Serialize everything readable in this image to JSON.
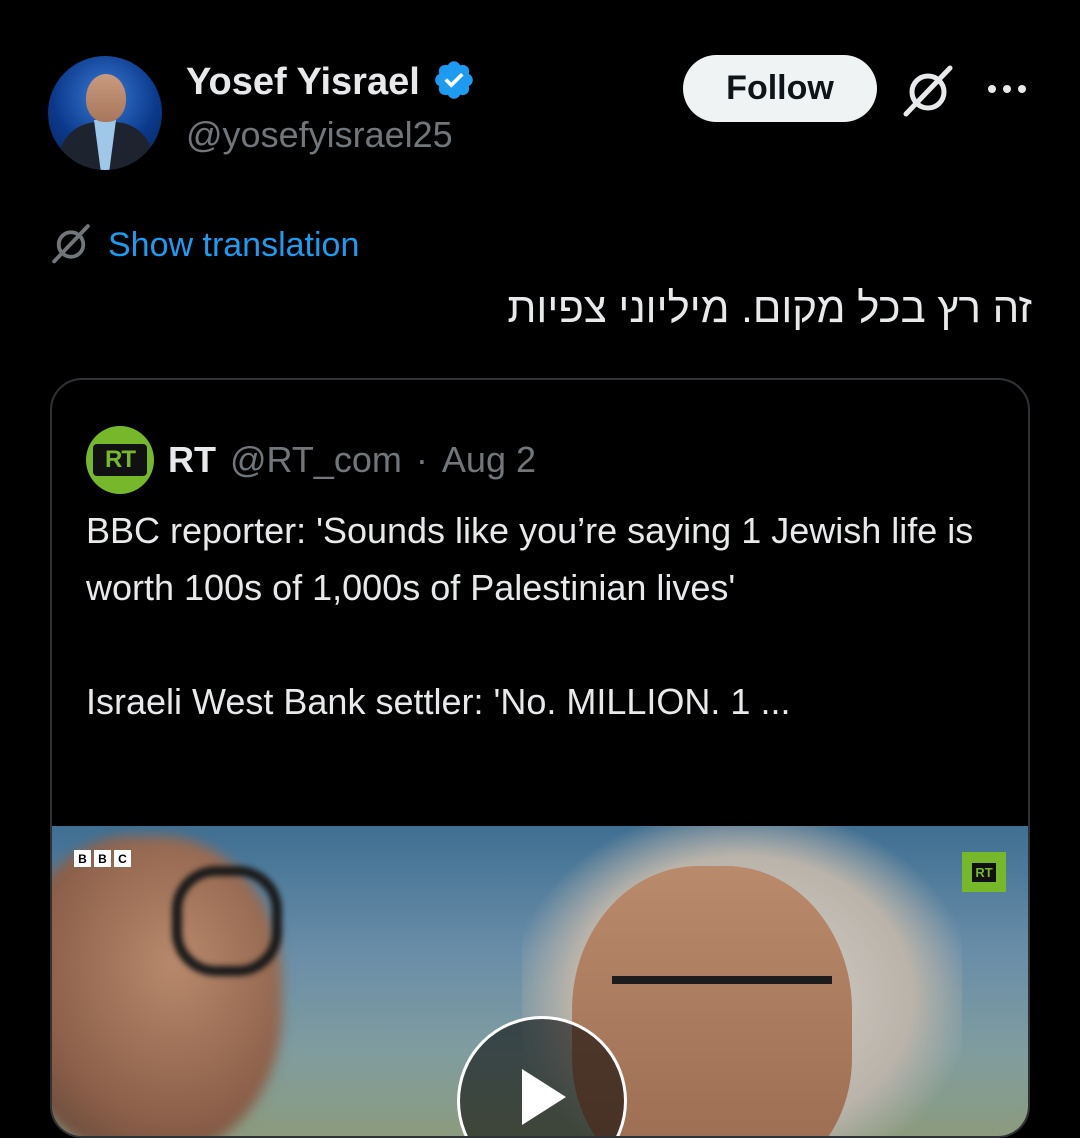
{
  "author": {
    "name": "Yosef Yisrael",
    "handle": "@yosefyisrael25",
    "verified_color": "#1d9bf0"
  },
  "actions": {
    "follow_label": "Follow",
    "grok_icon": "grok-icon",
    "more_icon": "more-icon"
  },
  "translation": {
    "label": "Show translation"
  },
  "post": {
    "text": "זה רץ בכל מקום. מיליוני צפיות"
  },
  "quote": {
    "avatar_label": "RT",
    "name": "RT",
    "handle": "@RT_com",
    "separator": "·",
    "date": "Aug 2",
    "text": "BBC reporter: 'Sounds like you’re saying 1 Jewish life is worth 100s of 1,000s of Palestinian lives'\n\nIsraeli West Bank settler: 'No. MILLION. 1 ...",
    "media": {
      "bbc_letters": [
        "B",
        "B",
        "C"
      ],
      "rt_watermark": "RT",
      "play_icon": "play-icon"
    }
  },
  "colors": {
    "background": "#000000",
    "text": "#e7e9ea",
    "muted": "#71767b",
    "link": "#1d9bf0",
    "rt_green": "#76b82a"
  }
}
